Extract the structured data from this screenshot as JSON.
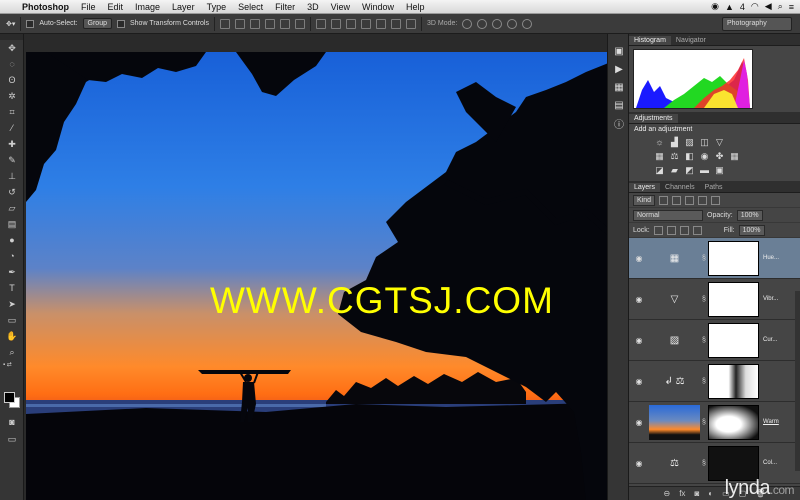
{
  "menubar": {
    "app_name": "Photoshop",
    "items": [
      "File",
      "Edit",
      "Image",
      "Layer",
      "Type",
      "Select",
      "Filter",
      "3D",
      "View",
      "Window",
      "Help"
    ],
    "badge_count": "4"
  },
  "options_bar": {
    "auto_select_label": "Auto-Select:",
    "auto_select_value": "Group",
    "show_transform_label": "Show Transform Controls",
    "mode_3d_label": "3D Mode:",
    "workspace": "Photography"
  },
  "panels": {
    "histogram_tabs": [
      "Histogram",
      "Navigator"
    ],
    "adjustments_tab": "Adjustments",
    "adjustments_title": "Add an adjustment",
    "layers_tabs": [
      "Layers",
      "Channels",
      "Paths"
    ],
    "kind_label": "Kind",
    "blend_mode": "Normal",
    "opacity_label": "Opacity:",
    "opacity_value": "100%",
    "lock_label": "Lock:",
    "fill_label": "Fill:",
    "fill_value": "100%",
    "layers": [
      {
        "name": "Hue...",
        "type": "adjustment",
        "selected": true
      },
      {
        "name": "Vibr...",
        "type": "adjustment",
        "selected": false
      },
      {
        "name": "Cur...",
        "type": "adjustment",
        "selected": false
      },
      {
        "name": "",
        "type": "adjustment",
        "selected": false
      },
      {
        "name": "Warm",
        "type": "image",
        "selected": false
      },
      {
        "name": "Col...",
        "type": "adjustment",
        "selected": false
      }
    ]
  },
  "document": {
    "watermark": "WWW.CGTSJ.COM"
  },
  "brand": {
    "name": "lynda",
    "suffix": ".com"
  },
  "colors": {
    "sky_top": "#1f6ad6",
    "sky_horizon": "#ff7a1a",
    "selected_layer": "#6a7f96",
    "watermark": "#ffff00"
  }
}
